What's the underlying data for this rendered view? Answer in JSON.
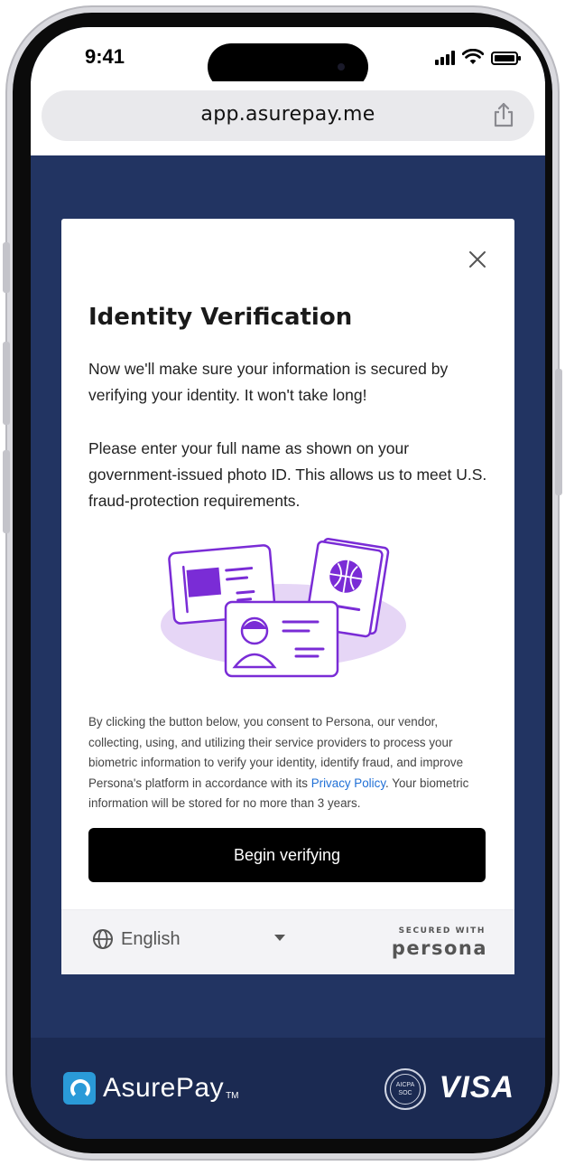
{
  "status_bar": {
    "time": "9:41"
  },
  "browser": {
    "url": "app.asurepay.me"
  },
  "modal": {
    "title": "Identity Verification",
    "paragraph1": "Now we'll make sure your information is secured by verifying your identity. It won't take long!",
    "paragraph2": "Please enter your full name as shown on your government-issued photo ID. This allows us to meet U.S. fraud-protection requirements.",
    "consent_before": "By clicking the button below, you consent to Persona, our vendor, collecting, using, and utilizing their service providers to process your biometric information to verify your identity, identify fraud, and improve Persona's platform in accordance with its ",
    "consent_link": "Privacy Policy",
    "consent_after": ". Your biometric information will be stored for no more than 3 years.",
    "begin_button": "Begin verifying",
    "footer": {
      "language": "English",
      "secured_with": "SECURED WITH",
      "persona": "persona"
    }
  },
  "app_footer": {
    "brand": "AsurePay",
    "brand_tm": "TM",
    "aicpa_top": "AICPA",
    "aicpa_bottom": "SOC",
    "visa": "VISA"
  },
  "colors": {
    "page_bg": "#223462",
    "footer_bg": "#1b2a52",
    "accent_purple": "#7a2cd6",
    "link_blue": "#1f6fd6",
    "button_black": "#000000"
  },
  "icons": [
    "close-icon",
    "share-icon",
    "globe-icon",
    "dropdown-caret-icon",
    "signal-icon",
    "wifi-icon",
    "battery-icon"
  ]
}
